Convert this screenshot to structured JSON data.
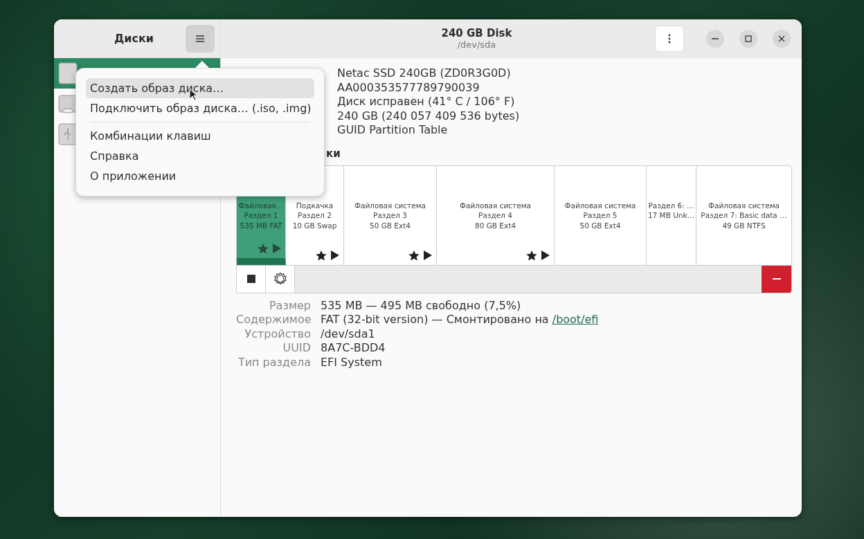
{
  "window": {
    "sidebar_title": "Диски",
    "title": "240 GB Disk",
    "subtitle": "/dev/sda"
  },
  "sidebar": {
    "items": [
      {
        "kind": "ssd",
        "selected": true
      },
      {
        "kind": "drive",
        "selected": false
      },
      {
        "kind": "usb",
        "selected": false
      }
    ]
  },
  "menu": {
    "items": [
      {
        "label": "Создать образ диска…",
        "highlighted": true,
        "separator_after": false
      },
      {
        "label": "Подключить образ диска… (.iso, .img)",
        "highlighted": false,
        "separator_after": true
      },
      {
        "label": "Комбинации клавиш",
        "highlighted": false,
        "separator_after": false
      },
      {
        "label": "Справка",
        "highlighted": false,
        "separator_after": false
      },
      {
        "label": "О приложении",
        "highlighted": false,
        "separator_after": false
      }
    ]
  },
  "disk_info": {
    "values": [
      "Netac SSD 240GB (ZD0R3G0D)",
      "AA000353577789790039",
      "Диск исправен (41° C / 106° F)",
      "240 GB (240 057 409 536 bytes)",
      "GUID Partition Table"
    ]
  },
  "volumes": {
    "heading": "ки",
    "partitions": [
      {
        "lines": [
          "Файловая…",
          "Раздел 1",
          "535 MB FAT"
        ],
        "selected": true,
        "mounted": true
      },
      {
        "lines": [
          "Подкачка",
          "Раздел 2",
          "10 GB Swap"
        ],
        "selected": false,
        "mounted": true
      },
      {
        "lines": [
          "Файловая система",
          "Раздел 3",
          "50 GB Ext4"
        ],
        "selected": false,
        "mounted": true
      },
      {
        "lines": [
          "Файловая система",
          "Раздел 4",
          "80 GB Ext4"
        ],
        "selected": false,
        "mounted": true
      },
      {
        "lines": [
          "Файловая система",
          "Раздел 5",
          "50 GB Ext4"
        ],
        "selected": false,
        "mounted": false
      },
      {
        "lines": [
          "Раздел 6: …",
          "17 MB Unk…"
        ],
        "selected": false,
        "mounted": false
      },
      {
        "lines": [
          "Файловая система",
          "Раздел 7: Basic data …",
          "49 GB NTFS"
        ],
        "selected": false,
        "mounted": false
      }
    ]
  },
  "details": [
    {
      "label": "Размер",
      "value": "535 MB — 495 MB свободно (7,5%)"
    },
    {
      "label": "Содержимое",
      "value": "FAT (32-bit version) — Смонтировано на ",
      "link": "/boot/efi"
    },
    {
      "label": "Устройство",
      "value": "/dev/sda1"
    },
    {
      "label": "UUID",
      "value": "8A7C-BDD4"
    },
    {
      "label": "Тип раздела",
      "value": "EFI System"
    }
  ]
}
